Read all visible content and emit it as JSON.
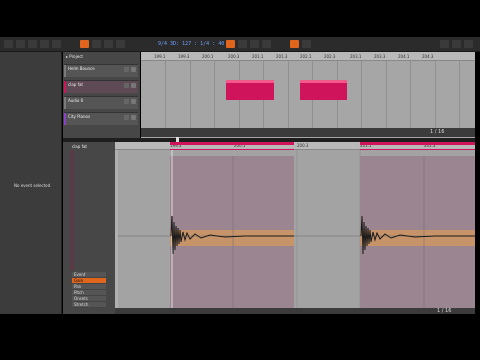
{
  "toolbar": {
    "timecode": "9/4   3D: 127 : 1/4 : 40"
  },
  "inspector": {
    "no_event_label": "No event selected"
  },
  "arranger": {
    "ruler_labels": [
      "199.1",
      "199.3",
      "200.1",
      "200.3",
      "201.1",
      "201.3",
      "202.1",
      "202.3",
      "203.1",
      "203.3",
      "204.1",
      "204.3"
    ],
    "tracks": [
      {
        "name": "Helm Bounce",
        "color": "#7a7a7a"
      },
      {
        "name": "clap fat",
        "color": "#d0145b"
      },
      {
        "name": "Audio 6",
        "color": "#7a7a7a"
      },
      {
        "name": "City Pianos",
        "color": "#8a3fc7"
      }
    ],
    "page_indicator": "1 / 16"
  },
  "editor": {
    "title": "clap fat",
    "ruler_labels": [
      "199.3",
      "200.1",
      "200.3",
      "201.1",
      "201.3"
    ],
    "clip_label_a": "clap fat1",
    "clip_label_b": "clap fat1",
    "modes": [
      "Event",
      "Gain",
      "Pan",
      "Pitch",
      "Onsets",
      "Stretch"
    ],
    "selected_mode": "Gain",
    "page_indicator": "1 / 16"
  },
  "colors": {
    "clip": "#d0145b",
    "accent": "#e0661e",
    "waveform": "#1a1a1a"
  }
}
